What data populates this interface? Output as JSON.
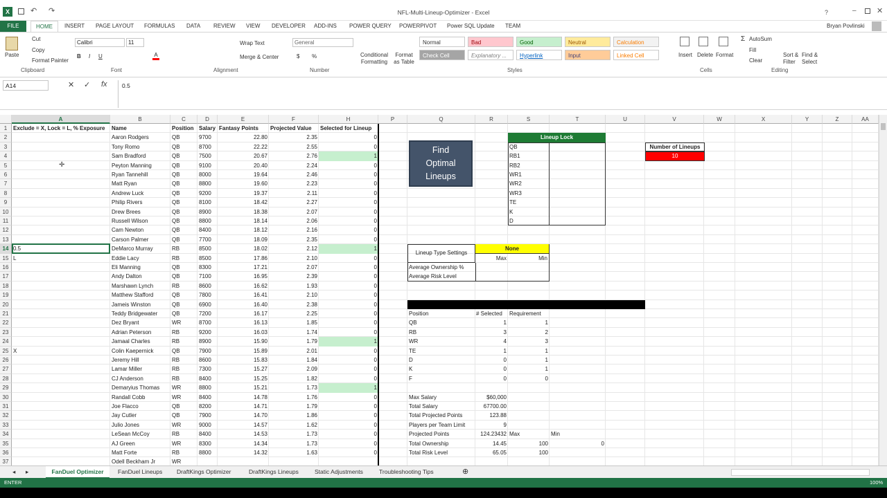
{
  "window": {
    "title": "NFL-Multi-Lineup-Optimizer - Excel",
    "user": "Bryan Povlinski"
  },
  "menu": [
    "FILE",
    "HOME",
    "INSERT",
    "PAGE LAYOUT",
    "FORMULAS",
    "DATA",
    "REVIEW",
    "VIEW",
    "DEVELOPER",
    "ADD-INS",
    "POWER QUERY",
    "POWERPIVOT",
    "Power SQL Update",
    "TEAM"
  ],
  "ribbon": {
    "paste": "Paste",
    "cut": "Cut",
    "copy": "Copy",
    "format_painter": "Format Painter",
    "clipboard": "Clipboard",
    "font_name": "Calibri",
    "font_size": "11",
    "font": "Font",
    "wrap_text": "Wrap Text",
    "merge_center": "Merge & Center",
    "alignment": "Alignment",
    "number_format": "General",
    "number": "Number",
    "cond_format": "Conditional Formatting",
    "format_table": "Format as Table",
    "styles_label": "Styles",
    "styles": [
      {
        "label": "Normal",
        "bg": "#ffffff",
        "fg": "#333333"
      },
      {
        "label": "Bad",
        "bg": "#ffc7ce",
        "fg": "#9c0006"
      },
      {
        "label": "Good",
        "bg": "#c6efce",
        "fg": "#006100"
      },
      {
        "label": "Neutral",
        "bg": "#ffeb9c",
        "fg": "#9c5700"
      },
      {
        "label": "Calculation",
        "bg": "#f2f2f2",
        "fg": "#fa7d00"
      },
      {
        "label": "Check Cell",
        "bg": "#a5a5a5",
        "fg": "#ffffff"
      },
      {
        "label": "Explanatory ...",
        "bg": "#ffffff",
        "fg": "#7f7f7f"
      },
      {
        "label": "Hyperlink",
        "bg": "#ffffff",
        "fg": "#0563c1"
      },
      {
        "label": "Input",
        "bg": "#ffcc99",
        "fg": "#3f3f76"
      },
      {
        "label": "Linked Cell",
        "bg": "#ffffff",
        "fg": "#fa7d00"
      }
    ],
    "insert": "Insert",
    "delete": "Delete",
    "format": "Format",
    "cells": "Cells",
    "autosum": "AutoSum",
    "fill": "Fill",
    "clear": "Clear",
    "sort_filter": "Sort & Filter",
    "find_select": "Find & Select",
    "editing": "Editing"
  },
  "formula": {
    "name_box": "A14",
    "value": "0.5"
  },
  "columns": [
    "A",
    "B",
    "C",
    "D",
    "E",
    "F",
    "H",
    "P",
    "Q",
    "R",
    "S",
    "T",
    "U",
    "V",
    "W",
    "X",
    "Y",
    "Z",
    "AA"
  ],
  "headers": {
    "a": "Exclude = X, Lock = L, % Exposure",
    "b": "Name",
    "c": "Position",
    "d": "Salary",
    "e": "Fantasy Points",
    "f": "Projected Value",
    "h": "Selected for Lineup"
  },
  "players": [
    {
      "a": "",
      "name": "Aaron Rodgers",
      "pos": "QB",
      "salary": "9700",
      "fp": "22.80",
      "pv": "2.35",
      "sel": "0"
    },
    {
      "a": "",
      "name": "Tony Romo",
      "pos": "QB",
      "salary": "8700",
      "fp": "22.22",
      "pv": "2.55",
      "sel": "0"
    },
    {
      "a": "",
      "name": "Sam Bradford",
      "pos": "QB",
      "salary": "7500",
      "fp": "20.67",
      "pv": "2.76",
      "sel": "1"
    },
    {
      "a": "",
      "name": "Peyton Manning",
      "pos": "QB",
      "salary": "9100",
      "fp": "20.40",
      "pv": "2.24",
      "sel": "0"
    },
    {
      "a": "",
      "name": "Ryan Tannehill",
      "pos": "QB",
      "salary": "8000",
      "fp": "19.64",
      "pv": "2.46",
      "sel": "0"
    },
    {
      "a": "",
      "name": "Matt Ryan",
      "pos": "QB",
      "salary": "8800",
      "fp": "19.60",
      "pv": "2.23",
      "sel": "0"
    },
    {
      "a": "",
      "name": "Andrew Luck",
      "pos": "QB",
      "salary": "9200",
      "fp": "19.37",
      "pv": "2.11",
      "sel": "0"
    },
    {
      "a": "",
      "name": "Philip Rivers",
      "pos": "QB",
      "salary": "8100",
      "fp": "18.42",
      "pv": "2.27",
      "sel": "0"
    },
    {
      "a": "",
      "name": "Drew Brees",
      "pos": "QB",
      "salary": "8900",
      "fp": "18.38",
      "pv": "2.07",
      "sel": "0"
    },
    {
      "a": "",
      "name": "Russell Wilson",
      "pos": "QB",
      "salary": "8800",
      "fp": "18.14",
      "pv": "2.06",
      "sel": "0"
    },
    {
      "a": "",
      "name": "Cam Newton",
      "pos": "QB",
      "salary": "8400",
      "fp": "18.12",
      "pv": "2.16",
      "sel": "0"
    },
    {
      "a": "",
      "name": "Carson Palmer",
      "pos": "QB",
      "salary": "7700",
      "fp": "18.09",
      "pv": "2.35",
      "sel": "0"
    },
    {
      "a": "0.5",
      "name": "DeMarco Murray",
      "pos": "RB",
      "salary": "8500",
      "fp": "18.02",
      "pv": "2.12",
      "sel": "1"
    },
    {
      "a": "L",
      "name": "Eddie Lacy",
      "pos": "RB",
      "salary": "8500",
      "fp": "17.86",
      "pv": "2.10",
      "sel": "0"
    },
    {
      "a": "",
      "name": "Eli Manning",
      "pos": "QB",
      "salary": "8300",
      "fp": "17.21",
      "pv": "2.07",
      "sel": "0"
    },
    {
      "a": "",
      "name": "Andy Dalton",
      "pos": "QB",
      "salary": "7100",
      "fp": "16.95",
      "pv": "2.39",
      "sel": "0"
    },
    {
      "a": "",
      "name": "Marshawn Lynch",
      "pos": "RB",
      "salary": "8600",
      "fp": "16.62",
      "pv": "1.93",
      "sel": "0"
    },
    {
      "a": "",
      "name": "Matthew Stafford",
      "pos": "QB",
      "salary": "7800",
      "fp": "16.41",
      "pv": "2.10",
      "sel": "0"
    },
    {
      "a": "",
      "name": "Jameis Winston",
      "pos": "QB",
      "salary": "6900",
      "fp": "16.40",
      "pv": "2.38",
      "sel": "0"
    },
    {
      "a": "",
      "name": "Teddy Bridgewater",
      "pos": "QB",
      "salary": "7200",
      "fp": "16.17",
      "pv": "2.25",
      "sel": "0"
    },
    {
      "a": "",
      "name": "Dez Bryant",
      "pos": "WR",
      "salary": "8700",
      "fp": "16.13",
      "pv": "1.85",
      "sel": "0"
    },
    {
      "a": "",
      "name": "Adrian Peterson",
      "pos": "RB",
      "salary": "9200",
      "fp": "16.03",
      "pv": "1.74",
      "sel": "0"
    },
    {
      "a": "",
      "name": "Jamaal Charles",
      "pos": "RB",
      "salary": "8900",
      "fp": "15.90",
      "pv": "1.79",
      "sel": "1"
    },
    {
      "a": "X",
      "name": "Colin Kaepernick",
      "pos": "QB",
      "salary": "7900",
      "fp": "15.89",
      "pv": "2.01",
      "sel": "0"
    },
    {
      "a": "",
      "name": "Jeremy Hill",
      "pos": "RB",
      "salary": "8600",
      "fp": "15.83",
      "pv": "1.84",
      "sel": "0"
    },
    {
      "a": "",
      "name": "Lamar Miller",
      "pos": "RB",
      "salary": "7300",
      "fp": "15.27",
      "pv": "2.09",
      "sel": "0"
    },
    {
      "a": "",
      "name": "CJ Anderson",
      "pos": "RB",
      "salary": "8400",
      "fp": "15.25",
      "pv": "1.82",
      "sel": "0"
    },
    {
      "a": "",
      "name": "Demaryius Thomas",
      "pos": "WR",
      "salary": "8800",
      "fp": "15.21",
      "pv": "1.73",
      "sel": "1"
    },
    {
      "a": "",
      "name": "Randall Cobb",
      "pos": "WR",
      "salary": "8400",
      "fp": "14.78",
      "pv": "1.76",
      "sel": "0"
    },
    {
      "a": "",
      "name": "Joe Flacco",
      "pos": "QB",
      "salary": "8200",
      "fp": "14.71",
      "pv": "1.79",
      "sel": "0"
    },
    {
      "a": "",
      "name": "Jay Cutler",
      "pos": "QB",
      "salary": "7900",
      "fp": "14.70",
      "pv": "1.86",
      "sel": "0"
    },
    {
      "a": "",
      "name": "Julio Jones",
      "pos": "WR",
      "salary": "9000",
      "fp": "14.57",
      "pv": "1.62",
      "sel": "0"
    },
    {
      "a": "",
      "name": "LeSean McCoy",
      "pos": "RB",
      "salary": "8400",
      "fp": "14.53",
      "pv": "1.73",
      "sel": "0"
    },
    {
      "a": "",
      "name": "AJ Green",
      "pos": "WR",
      "salary": "8300",
      "fp": "14.34",
      "pv": "1.73",
      "sel": "0"
    },
    {
      "a": "",
      "name": "Matt Forte",
      "pos": "RB",
      "salary": "8800",
      "fp": "14.32",
      "pv": "1.63",
      "sel": "0"
    },
    {
      "a": "",
      "name": "Odell Beckham Jr",
      "pos": "WR",
      "salary": "",
      "fp": "",
      "pv": "",
      "sel": ""
    }
  ],
  "button": {
    "label": "Find Optimal Lineups"
  },
  "lineup_lock": {
    "title": "Lineup Lock",
    "slots": [
      "QB",
      "RB1",
      "RB2",
      "WR1",
      "WR2",
      "WR3",
      "TE",
      "K",
      "D"
    ]
  },
  "num_lineups": {
    "label": "Number of Lineups",
    "value": "10"
  },
  "settings": {
    "label": "Lineup Type Settings",
    "value": "None",
    "max": "Max",
    "min": "Min",
    "avg_own": "Average Ownership %",
    "avg_risk": "Average Risk Level"
  },
  "positions": {
    "headers": [
      "Position",
      "# Selected",
      "Requirement"
    ],
    "rows": [
      [
        "QB",
        "1",
        "1"
      ],
      [
        "RB",
        "3",
        "2"
      ],
      [
        "WR",
        "4",
        "3"
      ],
      [
        "TE",
        "1",
        "1"
      ],
      [
        "D",
        "0",
        "1"
      ],
      [
        "K",
        "0",
        "1"
      ],
      [
        "F",
        "0",
        "0"
      ]
    ]
  },
  "summary": [
    {
      "label": "Max Salary",
      "v1": "$60,000",
      "v2": "",
      "v3": "",
      "v4": ""
    },
    {
      "label": "Total Salary",
      "v1": "67700.00",
      "v2": "",
      "v3": "",
      "v4": ""
    },
    {
      "label": "Total Projected Points",
      "v1": "123.88",
      "v2": "",
      "v3": "",
      "v4": ""
    },
    {
      "label": "Players per Team Limit",
      "v1": "9",
      "v2": "",
      "v3": "",
      "v4": ""
    },
    {
      "label": "Projected Points",
      "v1": "124.23432",
      "v2": "Max",
      "v3": "Min",
      "v4": ""
    },
    {
      "label": "Total Ownership",
      "v1": "14.45",
      "v2": "100",
      "v3": "",
      "v4": "0"
    },
    {
      "label": "Total Risk Level",
      "v1": "65.05",
      "v2": "100",
      "v3": "",
      "v4": ""
    }
  ],
  "sheets": [
    "FanDuel Optimizer",
    "FanDuel Lineups",
    "DraftKings Optimizer",
    "DraftKings Lineups",
    "Static Adjustments",
    "Troubleshooting Tips"
  ],
  "status": {
    "mode": "ENTER",
    "zoom": "100%"
  },
  "colors": {
    "excel_green": "#217346",
    "lock_green": "#1e7b34",
    "highlight": "#c6efce",
    "red": "#ff0000",
    "yellow": "#ffff00",
    "button": "#44546a"
  }
}
